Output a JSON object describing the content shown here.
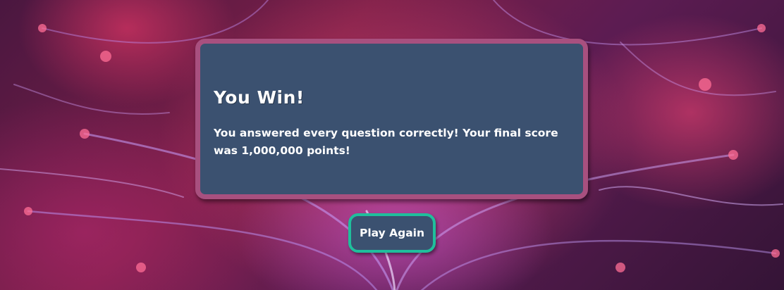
{
  "result": {
    "title": "You Win!",
    "message": "You answered every question correctly! Your final score was 1,000,000 points!"
  },
  "actions": {
    "play_again_label": "Play Again"
  },
  "colors": {
    "card_background": "#3b5170",
    "card_border": "#a8507f",
    "button_border": "#1fbf9c",
    "text": "#ffffff"
  },
  "background_image": "plasma-ball"
}
